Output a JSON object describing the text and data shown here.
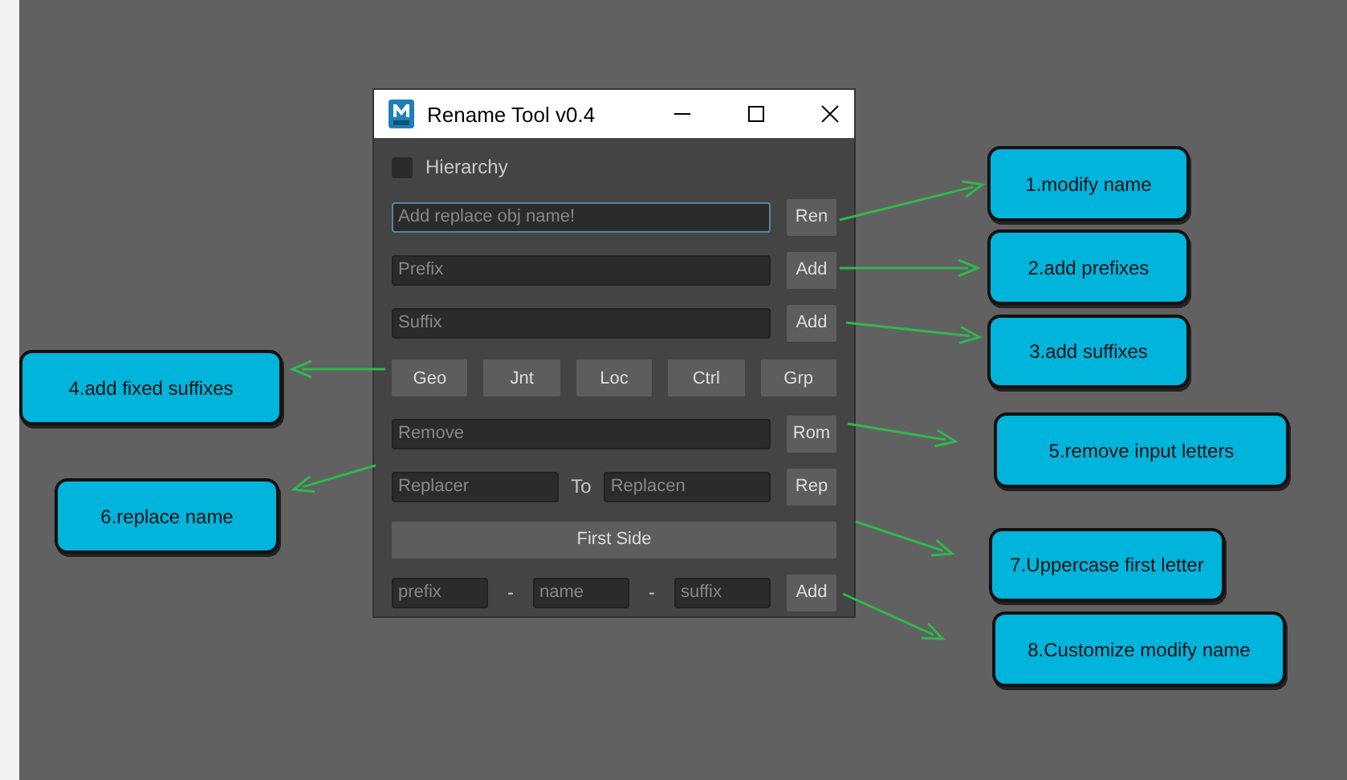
{
  "window": {
    "title": "Rename Tool v0.4"
  },
  "hierarchy": {
    "label": "Hierarchy",
    "checked": false
  },
  "rename_row": {
    "field": {
      "placeholder": "Add replace obj name!",
      "focused": true
    },
    "button": "Ren"
  },
  "prefix_row": {
    "field": {
      "placeholder": "Prefix",
      "focused": false
    },
    "button": "Add"
  },
  "suffix_row": {
    "field": {
      "placeholder": "Suffix",
      "focused": false
    },
    "button": "Add"
  },
  "suffix_buttons": [
    "Geo",
    "Jnt",
    "Loc",
    "Ctrl",
    "Grp"
  ],
  "remove_row": {
    "field": {
      "placeholder": "Remove",
      "focused": false
    },
    "button": "Rom"
  },
  "replace_row": {
    "from": {
      "placeholder": "Replacer",
      "focused": false
    },
    "to_label": "To",
    "to": {
      "placeholder": "Replacen",
      "focused": false
    },
    "button": "Rep"
  },
  "first_side_button": "First Side",
  "custom_row": {
    "fields": [
      {
        "placeholder": "prefix",
        "focused": false
      },
      {
        "placeholder": "name",
        "focused": false
      },
      {
        "placeholder": "suffix",
        "focused": false
      }
    ],
    "separator": "-",
    "button": "Add"
  },
  "callouts": [
    {
      "text": "1.modify name"
    },
    {
      "text": "2.add  prefixes"
    },
    {
      "text": "3.add suffixes"
    },
    {
      "text": "4.add fixed suffixes"
    },
    {
      "text": "5.remove input letters"
    },
    {
      "text": "6.replace name"
    },
    {
      "text": "7.Uppercase first letter"
    },
    {
      "text": "8.Customize modify name"
    }
  ]
}
